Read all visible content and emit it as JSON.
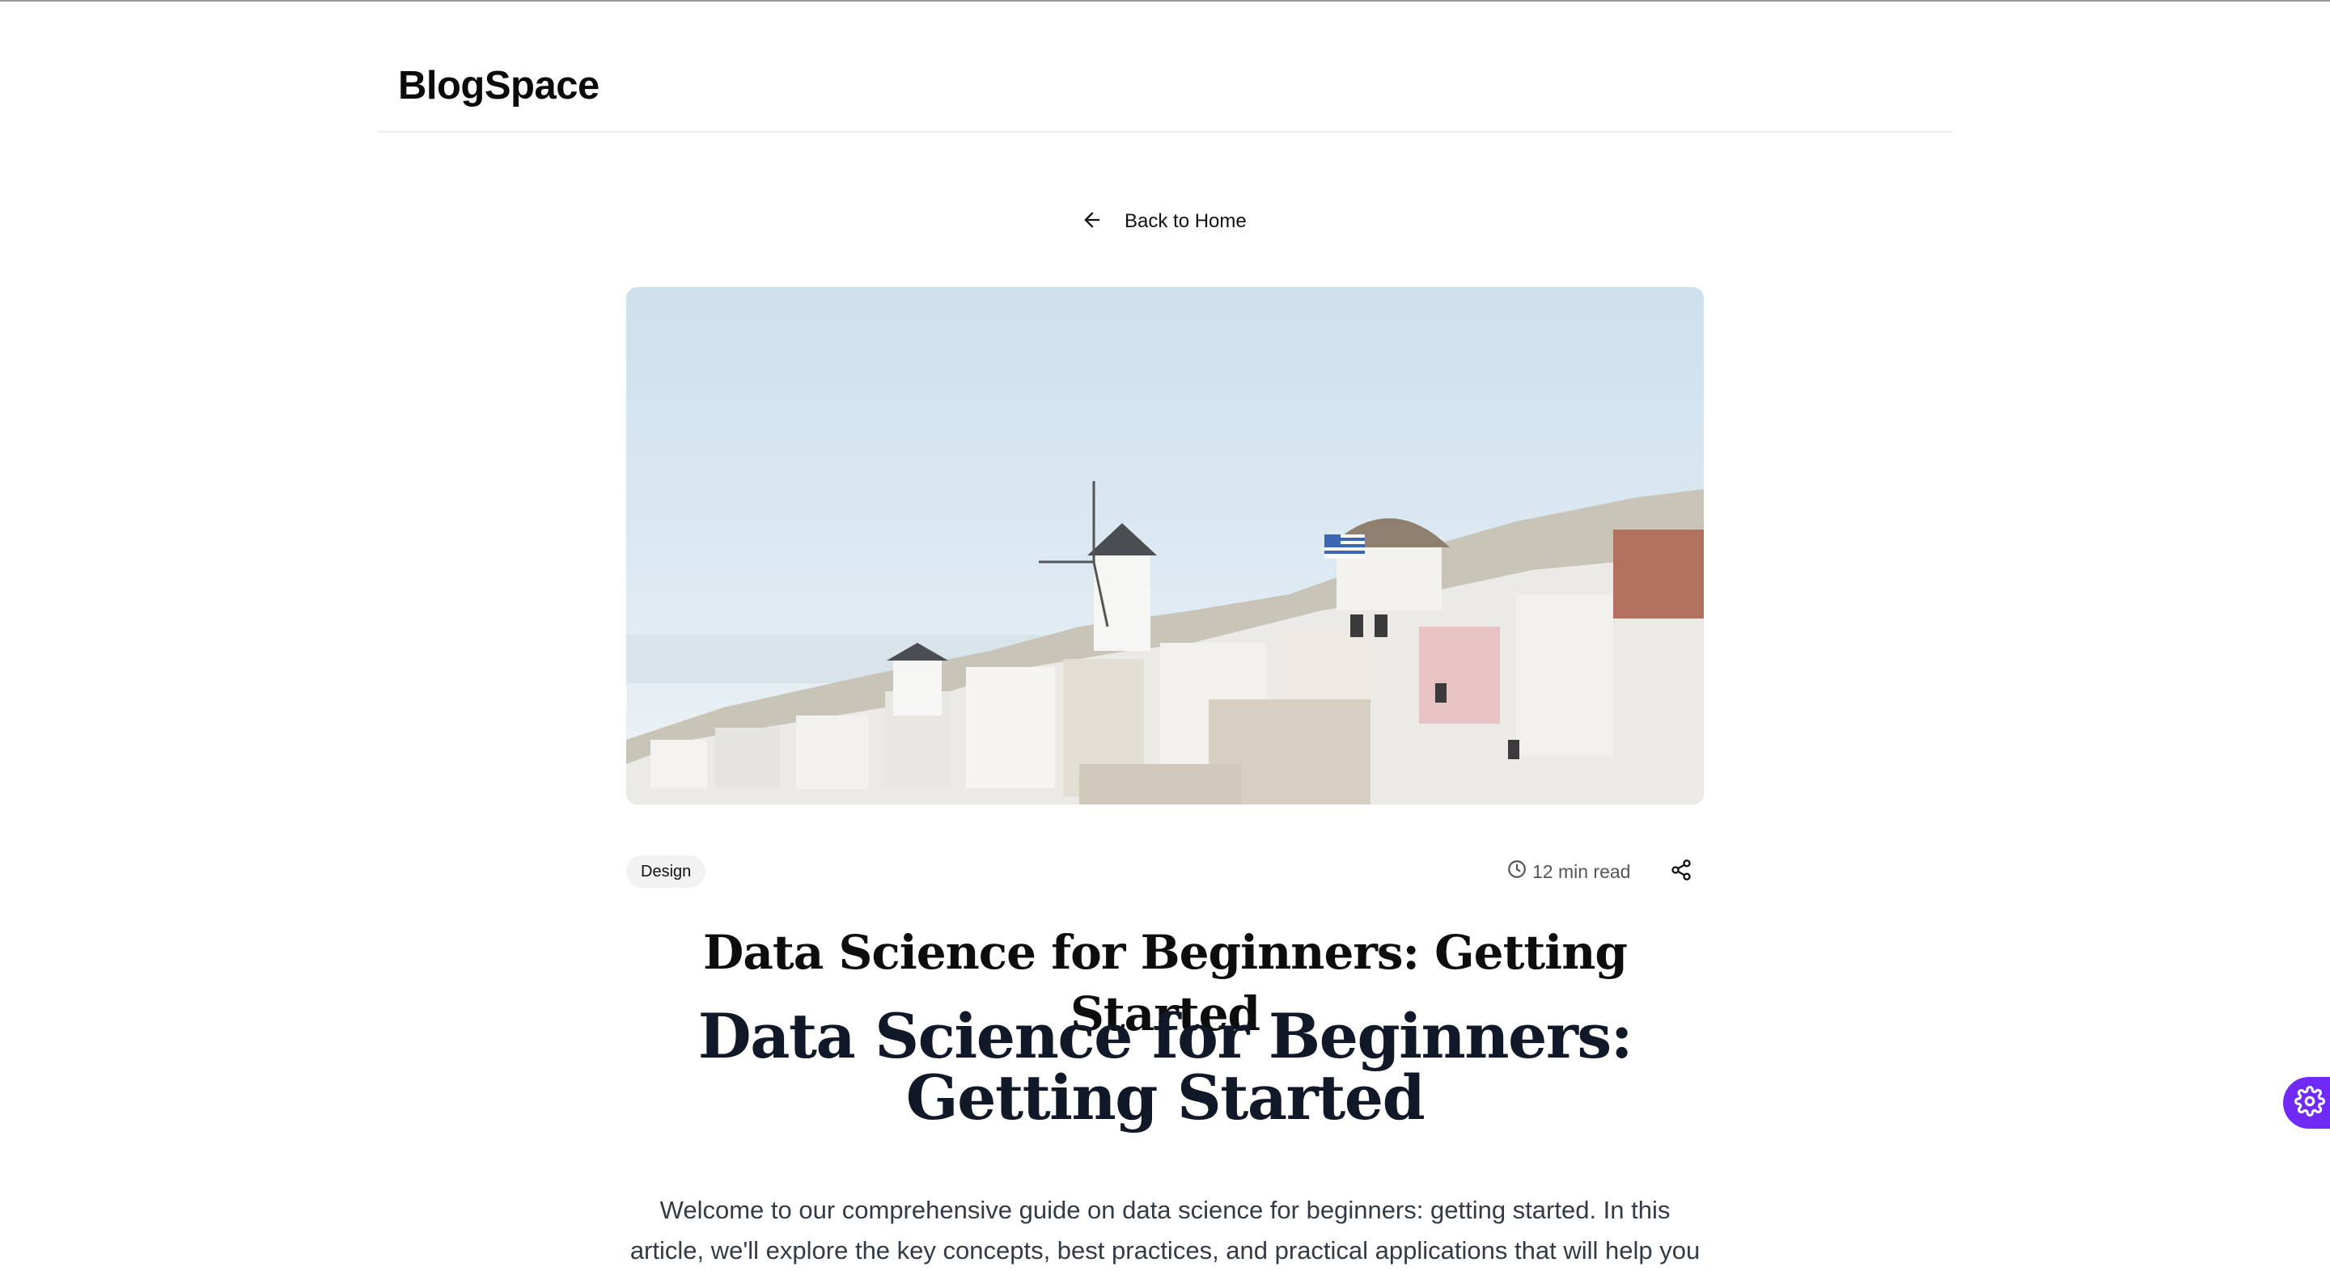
{
  "header": {
    "logo": "BlogSpace"
  },
  "nav": {
    "back_label": "Back to Home",
    "back_icon": "arrow-left-icon"
  },
  "hero": {
    "alt": "Whitewashed hillside village with windmills and a domed church beside the sea"
  },
  "post": {
    "category": "Design",
    "read_time": "12 min read",
    "title": "Data Science for Beginners: Getting Started",
    "heading": "Data Science for Beginners: Getting Started",
    "intro": "Welcome to our comprehensive guide on data science for beginners: getting started. In this article, we'll explore the key concepts, best practices, and practical applications that will help you"
  },
  "icons": {
    "clock": "clock-icon",
    "share": "share-icon",
    "settings": "gear-icon"
  },
  "colors": {
    "accent": "#6f2bf5",
    "heading": "#111827",
    "body_text": "#333b45"
  }
}
